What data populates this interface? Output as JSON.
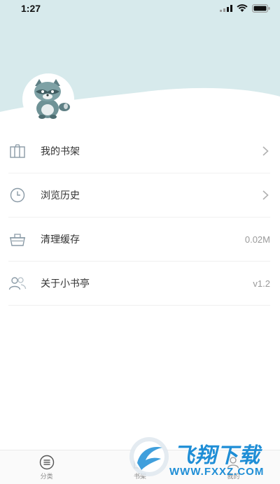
{
  "status_bar": {
    "time": "1:27"
  },
  "profile": {
    "avatar_icon": "raccoon-avatar"
  },
  "menu": {
    "items": [
      {
        "label": "我的书架",
        "icon": "bookshelf-icon",
        "value": "",
        "has_arrow": true
      },
      {
        "label": "浏览历史",
        "icon": "clock-icon",
        "value": "",
        "has_arrow": true
      },
      {
        "label": "清理缓存",
        "icon": "basket-icon",
        "value": "0.02M",
        "has_arrow": false
      },
      {
        "label": "关于小书亭",
        "icon": "users-icon",
        "value": "v1.2",
        "has_arrow": false
      }
    ]
  },
  "tab_bar": {
    "tabs": [
      {
        "label": "分类",
        "icon": "category-icon"
      },
      {
        "label": "书架",
        "icon": "bookshelf-icon"
      },
      {
        "label": "我的",
        "icon": "profile-icon"
      }
    ]
  },
  "watermark": {
    "brand": "飞翔下载",
    "url": "WWW.FXXZ.COM"
  },
  "colors": {
    "header_bg": "#d7eaec",
    "accent": "#1f8ed6",
    "icon_gray": "#8a9aa6"
  }
}
